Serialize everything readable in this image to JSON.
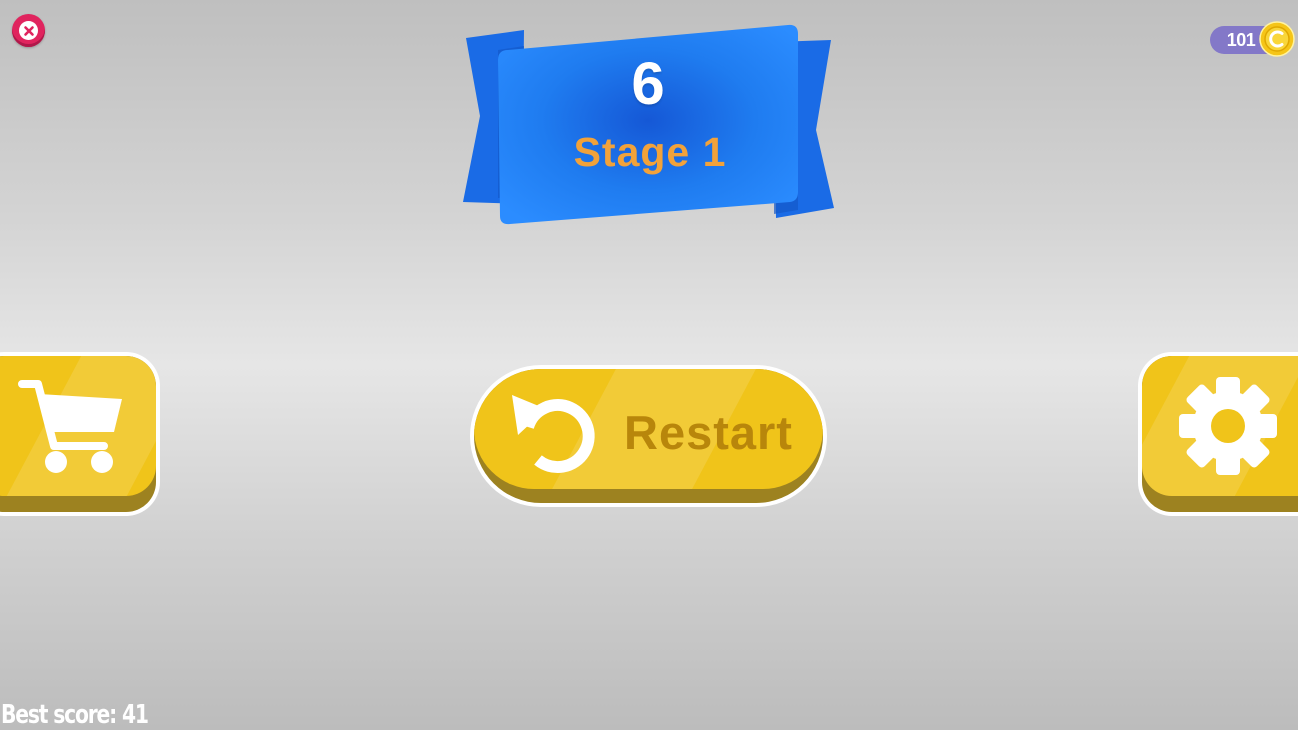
{
  "hud": {
    "coins": "101",
    "best_score_label": "Best score: 41"
  },
  "banner": {
    "level_number": "6",
    "stage_label": "Stage 1"
  },
  "buttons": {
    "restart_label": "Restart"
  },
  "icons": {
    "close": "close-icon",
    "coin": "coin-icon",
    "shop": "shopping-cart-icon",
    "restart": "restart-arrow-icon",
    "settings": "gear-icon"
  },
  "colors": {
    "banner_blue": "#1e7ef0",
    "button_yellow": "#f0c41a",
    "stage_orange": "#f2a23a",
    "restart_text": "#b8860b",
    "close_red": "#e0245e",
    "coin_pill": "#8378c8"
  }
}
